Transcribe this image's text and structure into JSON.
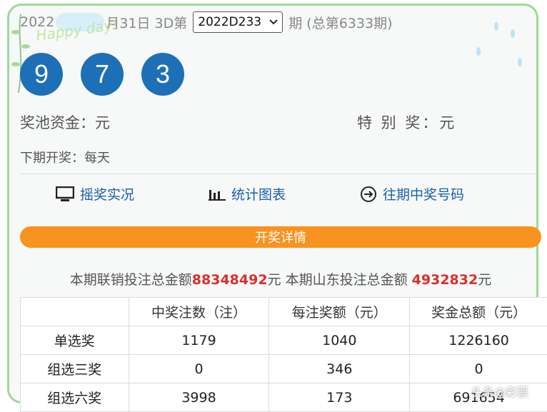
{
  "header": {
    "date_prefix": "2022",
    "date_suffix": "月31日",
    "lottery_name": "3D第",
    "period_selected": "2022D233",
    "period_suffix": "期",
    "total_period": "(总第6333期)"
  },
  "decoration": {
    "happy_text": "Happy day!"
  },
  "numbers": [
    "9",
    "7",
    "3"
  ],
  "pool": {
    "label": "奖池资金：元",
    "special_label": "特 别 奖：元"
  },
  "next_draw": "下期开奖：每天",
  "nav": {
    "live": "摇奖实况",
    "charts": "统计图表",
    "history": "往期中奖号码"
  },
  "detail_button": "开奖详情",
  "sales": {
    "prefix": "本期联销投注总金额",
    "total": "88348492",
    "unit1": "元 本期山东投注总金额 ",
    "shandong": "4932832",
    "unit2": "元"
  },
  "table": {
    "headers": [
      "",
      "中奖注数（注）",
      "每注奖额（元）",
      "奖金总额（元）"
    ],
    "rows": [
      [
        "单选奖",
        "1179",
        "1040",
        "1226160"
      ],
      [
        "组选三奖",
        "0",
        "346",
        "0"
      ],
      [
        "组选六奖",
        "3998",
        "173",
        "691654"
      ]
    ]
  },
  "watermark": "头条@彩票",
  "colors": {
    "ball": "#1d70b7",
    "accent_orange": "#f7931e",
    "highlight_red": "#d9302c",
    "link_blue": "#1a5fa6",
    "frame_green": "#9ed99a"
  }
}
